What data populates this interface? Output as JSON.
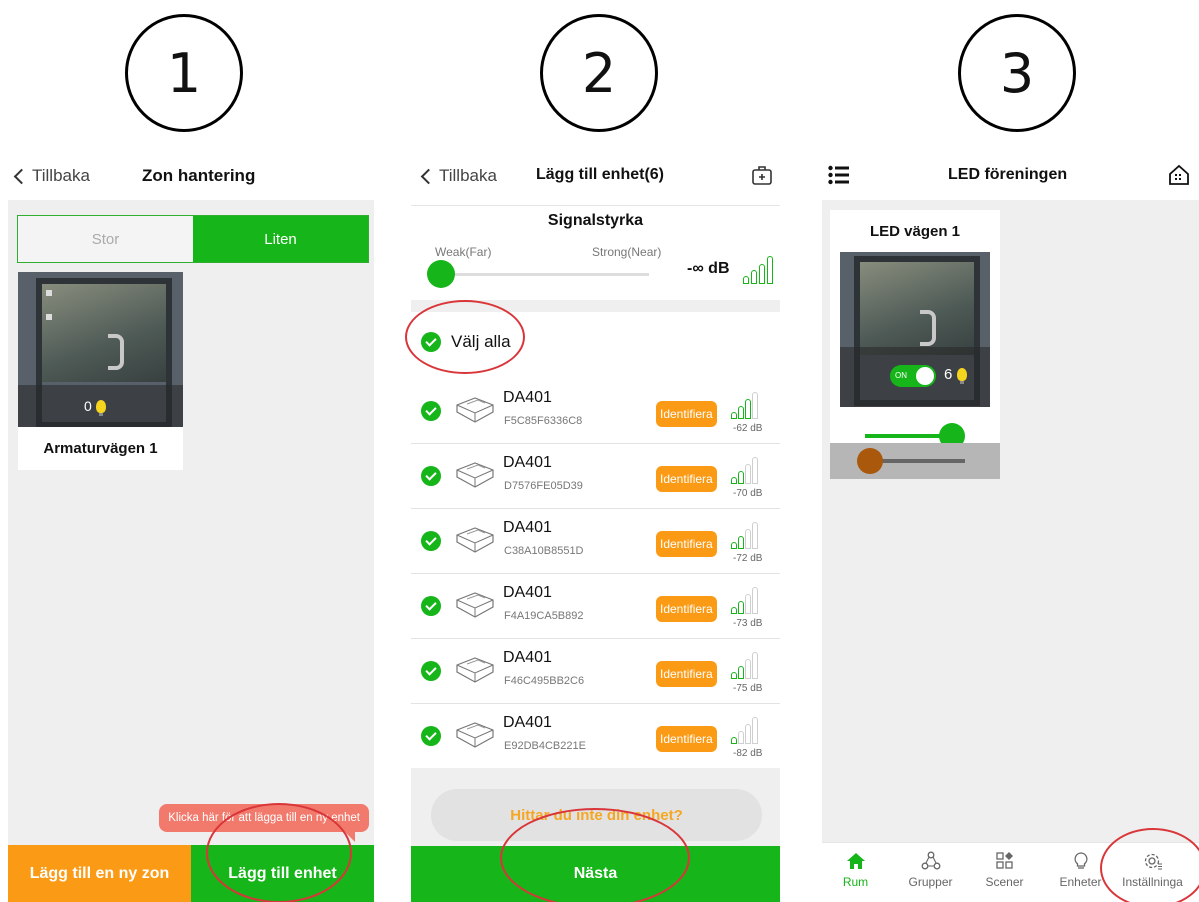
{
  "steps": [
    "1",
    "2",
    "3"
  ],
  "panel1": {
    "back_label": "Tillbaka",
    "title": "Zon hantering",
    "segments": [
      "Stor",
      "Liten"
    ],
    "zone": {
      "name": "Armaturvägen 1",
      "count": "0"
    },
    "tooltip": "Klicka här för att lägga till en ny enhet",
    "add_zone_label": "Lägg till en ny zon",
    "add_device_label": "Lägg till enhet",
    "colors": {
      "green": "#16b51a",
      "orange": "#fb9a14",
      "tooltip": "#f27a6c"
    }
  },
  "panel2": {
    "back_label": "Tillbaka",
    "title": "Lägg till enhet(6)",
    "signal_title": "Signalstyrka",
    "weak_label": "Weak(Far)",
    "strong_label": "Strong(Near)",
    "db_value": "-∞ dB",
    "select_all": "Välj alla",
    "identify_label": "Identifiera",
    "devices": [
      {
        "name": "DA401",
        "id": "F5C85F6336C8",
        "db": "-62 dB",
        "bars": 3
      },
      {
        "name": "DA401",
        "id": "D7576FE05D39",
        "db": "-70 dB",
        "bars": 2
      },
      {
        "name": "DA401",
        "id": "C38A10B8551D",
        "db": "-72 dB",
        "bars": 2
      },
      {
        "name": "DA401",
        "id": "F4A19CA5B892",
        "db": "-73 dB",
        "bars": 2
      },
      {
        "name": "DA401",
        "id": "F46C495BB2C6",
        "db": "-75 dB",
        "bars": 2
      },
      {
        "name": "DA401",
        "id": "E92DB4CB221E",
        "db": "-82 dB",
        "bars": 1
      }
    ],
    "not_found_label": "Hittar du inte din enhet?",
    "next_label": "Nästa"
  },
  "panel3": {
    "title": "LED föreningen",
    "room": {
      "name": "LED vägen 1",
      "toggle": "ON",
      "count": "6",
      "brightness": 1.0,
      "color_temp": 0.0
    },
    "tabs": [
      "Rum",
      "Grupper",
      "Scener",
      "Enheter",
      "Inställninga"
    ]
  }
}
